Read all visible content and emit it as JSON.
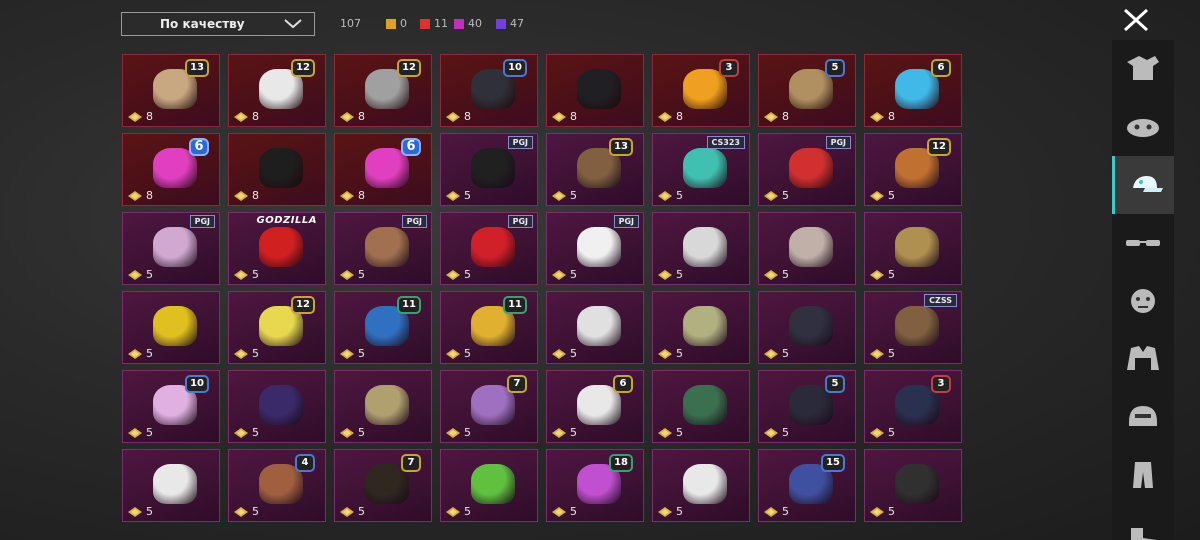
{
  "toolbar": {
    "sort_label": "По качеству",
    "total_count": "107",
    "quality_counts": [
      {
        "value": "0",
        "color": "#e0a020"
      },
      {
        "value": "11",
        "color": "#e03030"
      },
      {
        "value": "40",
        "color": "#c030c0"
      },
      {
        "value": "47",
        "color": "#7040e0"
      }
    ]
  },
  "sidebar": {
    "items": [
      {
        "icon": "outfit-icon"
      },
      {
        "icon": "mask-icon"
      },
      {
        "icon": "cap-icon",
        "active": true
      },
      {
        "icon": "glasses-icon"
      },
      {
        "icon": "face-icon"
      },
      {
        "icon": "jacket-icon"
      },
      {
        "icon": "helmet-icon"
      },
      {
        "icon": "pants-icon"
      },
      {
        "icon": "shoes-icon"
      }
    ]
  },
  "items": [
    {
      "rarity": "red",
      "color": "#c8a880",
      "badge": "13",
      "price": "8"
    },
    {
      "rarity": "red",
      "color": "#e8e8e8",
      "badge": "12",
      "price": "8"
    },
    {
      "rarity": "red",
      "color": "#a0a0a0",
      "badge": "12",
      "price": "8"
    },
    {
      "rarity": "red",
      "color": "#303038",
      "badge": "10",
      "badge_style": "blue",
      "price": "8"
    },
    {
      "rarity": "red",
      "color": "#202024",
      "price": "8"
    },
    {
      "rarity": "red",
      "color": "#f0a020",
      "badge": "3",
      "badge_style": "red",
      "price": "8"
    },
    {
      "rarity": "red",
      "color": "#b09060",
      "badge": "5",
      "badge_style": "blue",
      "price": "8"
    },
    {
      "rarity": "red",
      "color": "#40b8e8",
      "badge": "6",
      "price": "8"
    },
    {
      "rarity": "red",
      "color": "#e040c0",
      "badge": "6",
      "badge_style": "big6",
      "price": "8"
    },
    {
      "rarity": "red",
      "color": "#1e1e1e",
      "price": "8"
    },
    {
      "rarity": "red",
      "color": "#e040c0",
      "badge": "6",
      "badge_style": "big6",
      "price": "8"
    },
    {
      "rarity": "purple",
      "color": "#202020",
      "tag": "PGJ",
      "price": "5"
    },
    {
      "rarity": "purple",
      "color": "#806040",
      "badge": "13",
      "price": "5"
    },
    {
      "rarity": "purple",
      "color": "#40c0b0",
      "tag": "CS323",
      "price": "5"
    },
    {
      "rarity": "purple",
      "color": "#d03030",
      "tag": "PGJ",
      "price": "5"
    },
    {
      "rarity": "purple",
      "color": "#c07030",
      "badge": "12",
      "price": "5"
    },
    {
      "rarity": "purple",
      "color": "#d0a8d0",
      "tag": "PGJ",
      "price": "5"
    },
    {
      "rarity": "purple",
      "color": "#d02020",
      "tag": "GODZILLA",
      "tag_style": "godzilla",
      "price": "5"
    },
    {
      "rarity": "purple",
      "color": "#a07050",
      "tag": "PGJ",
      "price": "5"
    },
    {
      "rarity": "purple",
      "color": "#d02028",
      "tag": "PGJ",
      "price": "5"
    },
    {
      "rarity": "purple",
      "color": "#f0f0f0",
      "tag": "PGJ",
      "price": "5"
    },
    {
      "rarity": "purple",
      "color": "#d8d8d8",
      "price": "5"
    },
    {
      "rarity": "purple",
      "color": "#c0b0a8",
      "price": "5"
    },
    {
      "rarity": "purple",
      "color": "#b09050",
      "price": "5"
    },
    {
      "rarity": "purple",
      "color": "#e0c020",
      "price": "5"
    },
    {
      "rarity": "purple",
      "color": "#e8d850",
      "badge": "12",
      "price": "5"
    },
    {
      "rarity": "purple",
      "color": "#3070c0",
      "badge": "11",
      "badge_style": "green",
      "price": "5"
    },
    {
      "rarity": "purple",
      "color": "#e0b030",
      "badge": "11",
      "badge_style": "green",
      "price": "5"
    },
    {
      "rarity": "purple",
      "color": "#e0e0e0",
      "price": "5"
    },
    {
      "rarity": "purple",
      "color": "#b0b080",
      "price": "5"
    },
    {
      "rarity": "purple",
      "color": "#303040",
      "price": "5"
    },
    {
      "rarity": "purple",
      "color": "#806040",
      "tag": "CZSS",
      "price": "5"
    },
    {
      "rarity": "purple",
      "color": "#e0b0e0",
      "badge": "10",
      "badge_style": "blue",
      "price": "5"
    },
    {
      "rarity": "purple",
      "color": "#3a2a6a",
      "price": "5"
    },
    {
      "rarity": "purple",
      "color": "#b0a070",
      "price": "5"
    },
    {
      "rarity": "purple",
      "color": "#a070c0",
      "badge": "7",
      "price": "5"
    },
    {
      "rarity": "purple",
      "color": "#e8e8e8",
      "badge": "6",
      "price": "5"
    },
    {
      "rarity": "purple",
      "color": "#3a7050",
      "price": "5"
    },
    {
      "rarity": "purple",
      "color": "#2a2a3a",
      "badge": "5",
      "badge_style": "blue",
      "price": "5"
    },
    {
      "rarity": "purple",
      "color": "#2a3050",
      "badge": "3",
      "badge_style": "red",
      "price": "5"
    },
    {
      "rarity": "purple",
      "color": "#e8e8e8",
      "price": "5"
    },
    {
      "rarity": "purple",
      "color": "#a06040",
      "badge": "4",
      "badge_style": "blue",
      "price": "5"
    },
    {
      "rarity": "purple",
      "color": "#302820",
      "badge": "7",
      "price": "5"
    },
    {
      "rarity": "purple",
      "color": "#60c040",
      "price": "5"
    },
    {
      "rarity": "purple",
      "color": "#c050d0",
      "badge": "18",
      "badge_style": "green",
      "price": "5"
    },
    {
      "rarity": "purple",
      "color": "#e8e8e8",
      "price": "5"
    },
    {
      "rarity": "purple",
      "color": "#4050a0",
      "badge": "15",
      "badge_style": "blue",
      "price": "5"
    },
    {
      "rarity": "purple",
      "color": "#303030",
      "price": "5"
    }
  ]
}
